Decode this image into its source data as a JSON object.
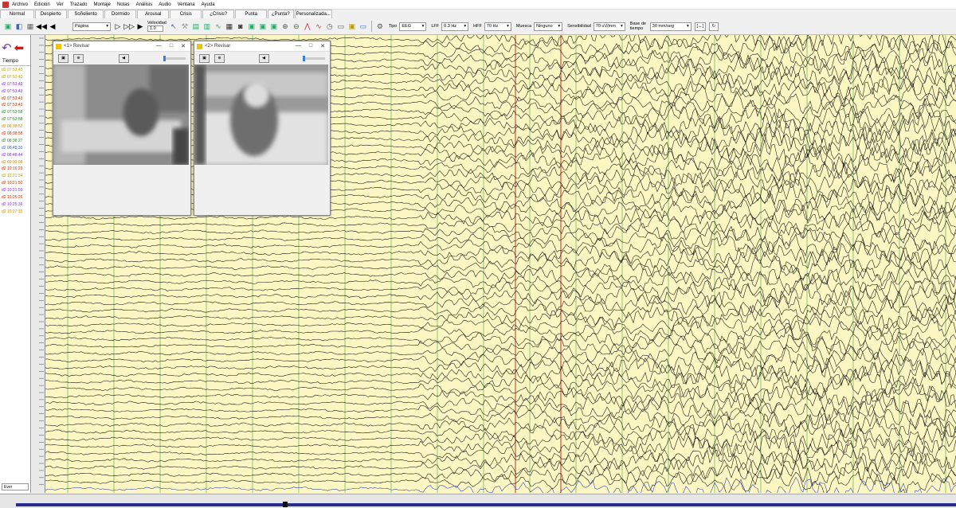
{
  "menu": [
    "Archivo",
    "Edición",
    "Ver",
    "Trazado",
    "Montaje",
    "Notas",
    "Análisis",
    "Audio",
    "Ventana",
    "Ayuda"
  ],
  "label_buttons": [
    "Normal",
    "Despierto",
    "Soñoliento",
    "Dormido",
    "Arousal",
    "Crisis",
    "¿Crisis?",
    "Punta",
    "¿Punta?",
    "Personalizada..."
  ],
  "toolbar": {
    "page_label": "Página",
    "speed_label": "Velocidad",
    "speed_value": "1.0",
    "type_label": "Tipo",
    "type_value": "EEG",
    "lff_label": "LFF",
    "lff_value": "0.3 Hz",
    "hff_label": "HFF",
    "hff_value": "70 Hz",
    "notch_label": "Muesca",
    "notch_value": "Ninguno",
    "sens_label": "Sensibilidad",
    "sens_value": "70 uV/mm",
    "timebase_label": "Base de tiempo",
    "timebase_value": "30 mm/seg",
    "bracket_btn": "[↔]"
  },
  "events": {
    "header": "Tiempo",
    "items": [
      {
        "time": "d2 07:53:43",
        "color": "#b7a400"
      },
      {
        "time": "d2 07:53:43",
        "color": "#b7a400"
      },
      {
        "time": "d2 07:53:43",
        "color": "#8a2be2"
      },
      {
        "time": "d2 07:53:43",
        "color": "#8a2be2"
      },
      {
        "time": "d2 07:53:43",
        "color": "#cc3300"
      },
      {
        "time": "d2 07:53:43",
        "color": "#cc3300"
      },
      {
        "time": "d2 07:53:58",
        "color": "#2a8a2a"
      },
      {
        "time": "d2 07:53:58",
        "color": "#2a8a2a"
      },
      {
        "time": "d2 08:38:52",
        "color": "#d08a00"
      },
      {
        "time": "d2 08:38:58",
        "color": "#cc3300"
      },
      {
        "time": "d2 08:38:27",
        "color": "#2a8a2a"
      },
      {
        "time": "d2 08:48:30",
        "color": "#2a6acc"
      },
      {
        "time": "d2 08:48:44",
        "color": "#8a2be2"
      },
      {
        "time": "d2 09:09:08",
        "color": "#d08a00"
      },
      {
        "time": "d2 10:16:29",
        "color": "#cc3300"
      },
      {
        "time": "d2 10:21:34",
        "color": "#b7a400"
      },
      {
        "time": "d2 10:21:50",
        "color": "#cc3300"
      },
      {
        "time": "d2 10:21:59",
        "color": "#8a2be2"
      },
      {
        "time": "d2 10:25:26",
        "color": "#cc3300"
      },
      {
        "time": "d2 10:25:36",
        "color": "#8a2be2"
      },
      {
        "time": "d2 10:27:15",
        "color": "#d08a00"
      }
    ],
    "footer": "Ever"
  },
  "video1": {
    "title": "<1> Revisar"
  },
  "video2": {
    "title": "<2> Revisar"
  },
  "colors": {
    "eeg_bg": "#fbf6c2",
    "trace": "#111111",
    "grid_green": "#3aa23a",
    "marker_red": "#b40000",
    "scroll_track": "#2b2d8c"
  }
}
